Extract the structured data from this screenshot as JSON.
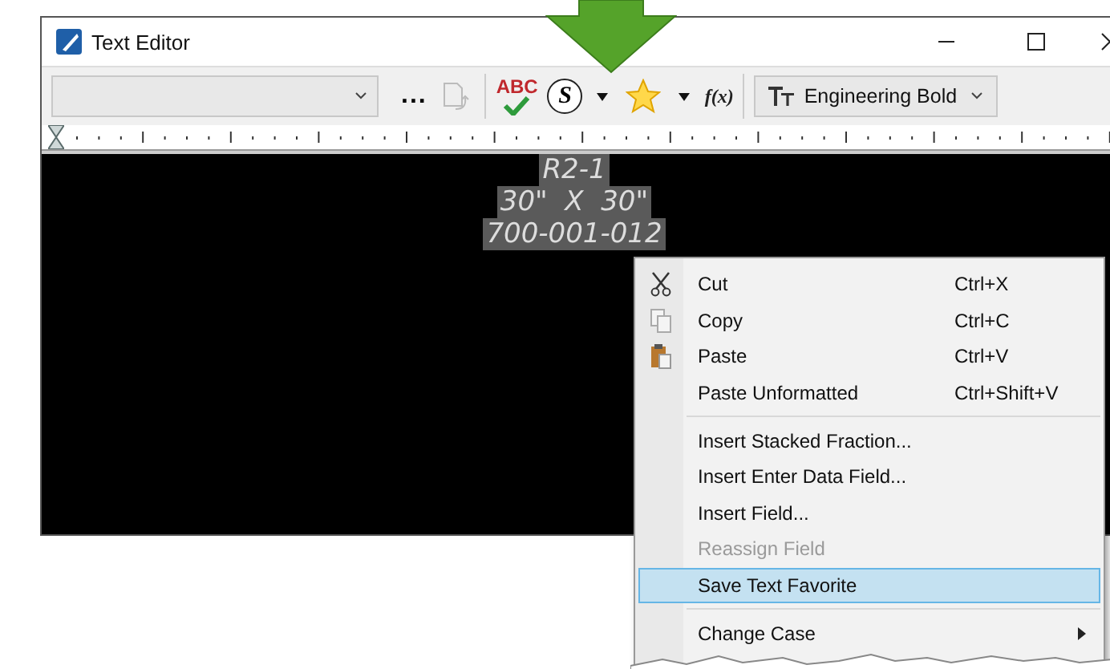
{
  "window": {
    "title": "Text Editor"
  },
  "toolbar": {
    "buttons": [
      {
        "kind": "combo"
      },
      {
        "kind": "more",
        "label": "..."
      },
      {
        "kind": "paste-style"
      },
      {
        "kind": "spell",
        "label": "ABC"
      },
      {
        "kind": "symbol",
        "label": "S"
      },
      {
        "kind": "caret"
      },
      {
        "kind": "favorite"
      },
      {
        "kind": "caret"
      },
      {
        "kind": "field",
        "label": "f(x)"
      },
      {
        "kind": "font",
        "label": "Engineering Bold"
      }
    ]
  },
  "editor": {
    "lines": [
      {
        "text": "R2-1",
        "selected": true
      },
      {
        "text": "30\"  X  30\"",
        "selected": true
      },
      {
        "text": "700-001-012",
        "selected": true
      }
    ]
  },
  "context_menu": {
    "items": [
      {
        "kind": "item",
        "label": "Cut",
        "shortcut": "Ctrl+X",
        "disabled": false,
        "selected": false
      },
      {
        "kind": "item",
        "label": "Copy",
        "shortcut": "Ctrl+C",
        "disabled": false,
        "selected": false
      },
      {
        "kind": "item",
        "label": "Paste",
        "shortcut": "Ctrl+V",
        "disabled": false,
        "selected": false
      },
      {
        "kind": "item",
        "label": "Paste Unformatted",
        "shortcut": "Ctrl+Shift+V",
        "disabled": false,
        "selected": false
      },
      {
        "kind": "separator"
      },
      {
        "kind": "item",
        "label": "Insert Stacked Fraction...",
        "disabled": false,
        "selected": false
      },
      {
        "kind": "item",
        "label": "Insert Enter Data Field...",
        "disabled": false,
        "selected": false
      },
      {
        "kind": "item",
        "label": "Insert Field...",
        "disabled": false,
        "selected": false
      },
      {
        "kind": "item",
        "label": "Reassign Field",
        "disabled": true,
        "selected": false
      },
      {
        "kind": "item",
        "label": "Save Text Favorite",
        "disabled": false,
        "selected": true
      },
      {
        "kind": "separator"
      },
      {
        "kind": "item",
        "label": "Change Case",
        "submenu": true,
        "disabled": false,
        "selected": false
      }
    ]
  }
}
